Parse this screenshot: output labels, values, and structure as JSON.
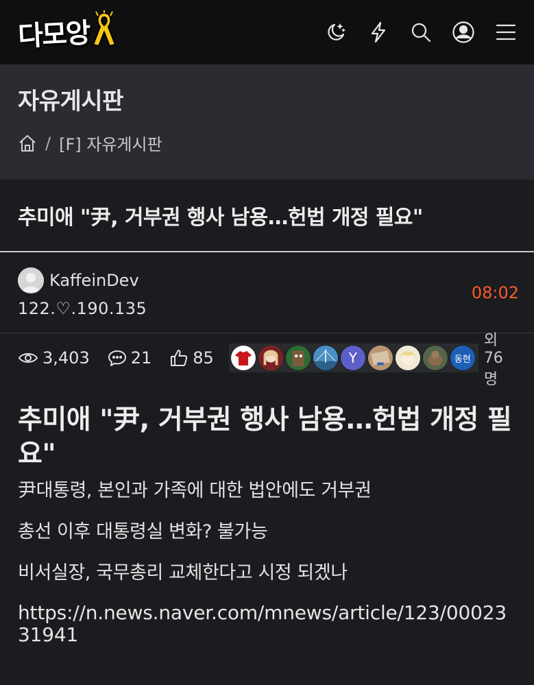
{
  "header": {
    "logo_text": "다모앙",
    "icons": [
      "moon-stars-icon",
      "lightning-icon",
      "search-icon",
      "user-circle-icon",
      "menu-icon"
    ]
  },
  "board": {
    "title": "자유게시판",
    "breadcrumb": {
      "home_icon": "home-icon",
      "separator": "/",
      "current": "[F] 자유게시판"
    }
  },
  "post": {
    "title": "추미애 \"尹, 거부권 행사 남용…헌법 개정 필요\"",
    "author": "KaffeinDev",
    "ip": "122.♡.190.135",
    "time": "08:02",
    "views": "3,403",
    "comments": "21",
    "likes": "85",
    "likers": [
      {
        "label": "",
        "color": "#ffffff"
      },
      {
        "label": "",
        "color": "#f0d9c8"
      },
      {
        "label": "",
        "color": "#3e6b3a"
      },
      {
        "label": "",
        "color": "#3f7fb0"
      },
      {
        "label": "Y",
        "color": "#5b5fc7"
      },
      {
        "label": "",
        "color": "#c9a886"
      },
      {
        "label": "",
        "color": "#e9e4cf"
      },
      {
        "label": "",
        "color": "#4d5a44"
      },
      {
        "label": "동현",
        "color": "#1d5fb5"
      }
    ],
    "likers_more": "외 76명",
    "body": {
      "heading": "추미애 \"尹, 거부권 행사 남용…헌법 개정 필요\"",
      "paragraphs": [
        "尹대통령, 본인과 가족에 대한 법안에도 거부권",
        "총선 이후 대통령실 변화? 불가능",
        "비서실장, 국무총리 교체한다고 시정 되겠나"
      ],
      "link": "https://n.news.naver.com/mnews/article/123/0002331941"
    }
  }
}
